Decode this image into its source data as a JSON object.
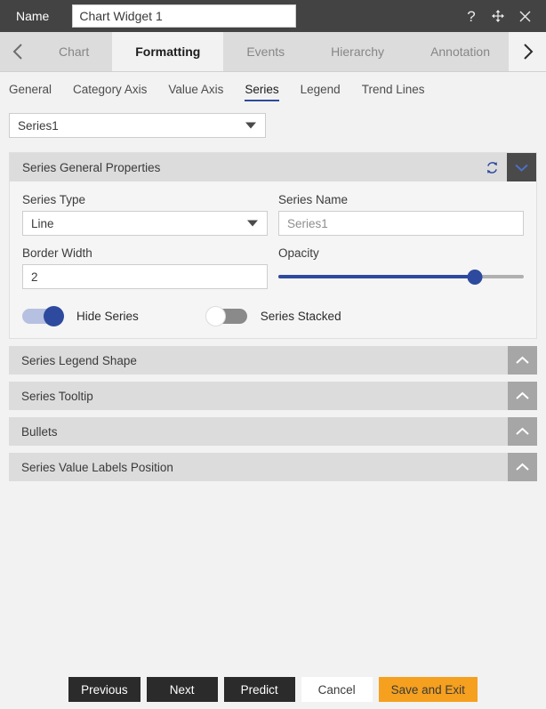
{
  "titlebar": {
    "name_label": "Name",
    "name_value": "Chart Widget 1",
    "help_icon": "question-mark-icon",
    "move_icon": "move-arrows-icon",
    "close_icon": "close-x-icon"
  },
  "tabstrip": {
    "prev_icon": "chevron-left-icon",
    "next_icon": "chevron-right-icon",
    "tabs": [
      {
        "label": "Chart",
        "active": false
      },
      {
        "label": "Formatting",
        "active": true
      },
      {
        "label": "Events",
        "active": false
      },
      {
        "label": "Hierarchy",
        "active": false
      },
      {
        "label": "Annotation",
        "active": false
      }
    ]
  },
  "subtabs": [
    {
      "label": "General",
      "active": false
    },
    {
      "label": "Category Axis",
      "active": false
    },
    {
      "label": "Value Axis",
      "active": false
    },
    {
      "label": "Series",
      "active": true
    },
    {
      "label": "Legend",
      "active": false
    },
    {
      "label": "Trend Lines",
      "active": false
    }
  ],
  "series_selector": {
    "value": "Series1",
    "caret_icon": "caret-down-icon"
  },
  "panels": {
    "general": {
      "title": "Series General Properties",
      "refresh_icon": "refresh-icon",
      "collapse_icon": "chevron-down-icon",
      "series_type": {
        "label": "Series Type",
        "value": "Line",
        "caret_icon": "caret-down-icon"
      },
      "series_name": {
        "label": "Series Name",
        "value": "Series1"
      },
      "border_width": {
        "label": "Border Width",
        "value": "2"
      },
      "opacity": {
        "label": "Opacity",
        "percent": 80
      },
      "hide_series": {
        "label": "Hide Series",
        "on": true
      },
      "series_stacked": {
        "label": "Series Stacked",
        "on": false
      }
    },
    "collapsed": [
      {
        "title": "Series Legend Shape",
        "expand_icon": "chevron-up-icon"
      },
      {
        "title": "Series Tooltip",
        "expand_icon": "chevron-up-icon"
      },
      {
        "title": "Bullets",
        "expand_icon": "chevron-up-icon"
      },
      {
        "title": "Series Value Labels Position",
        "expand_icon": "chevron-up-icon"
      }
    ]
  },
  "footer": {
    "buttons": [
      {
        "label": "Previous",
        "style": "dark"
      },
      {
        "label": "Next",
        "style": "dark"
      },
      {
        "label": "Predict",
        "style": "dark"
      },
      {
        "label": "Cancel",
        "style": "plain"
      },
      {
        "label": "Save and Exit",
        "style": "primary"
      }
    ]
  },
  "colors": {
    "accent_blue": "#2e4a9e",
    "primary_orange": "#f5a01e",
    "titlebar": "#434343",
    "panel_header": "#dcdcdc",
    "background": "#f2f2f2"
  }
}
